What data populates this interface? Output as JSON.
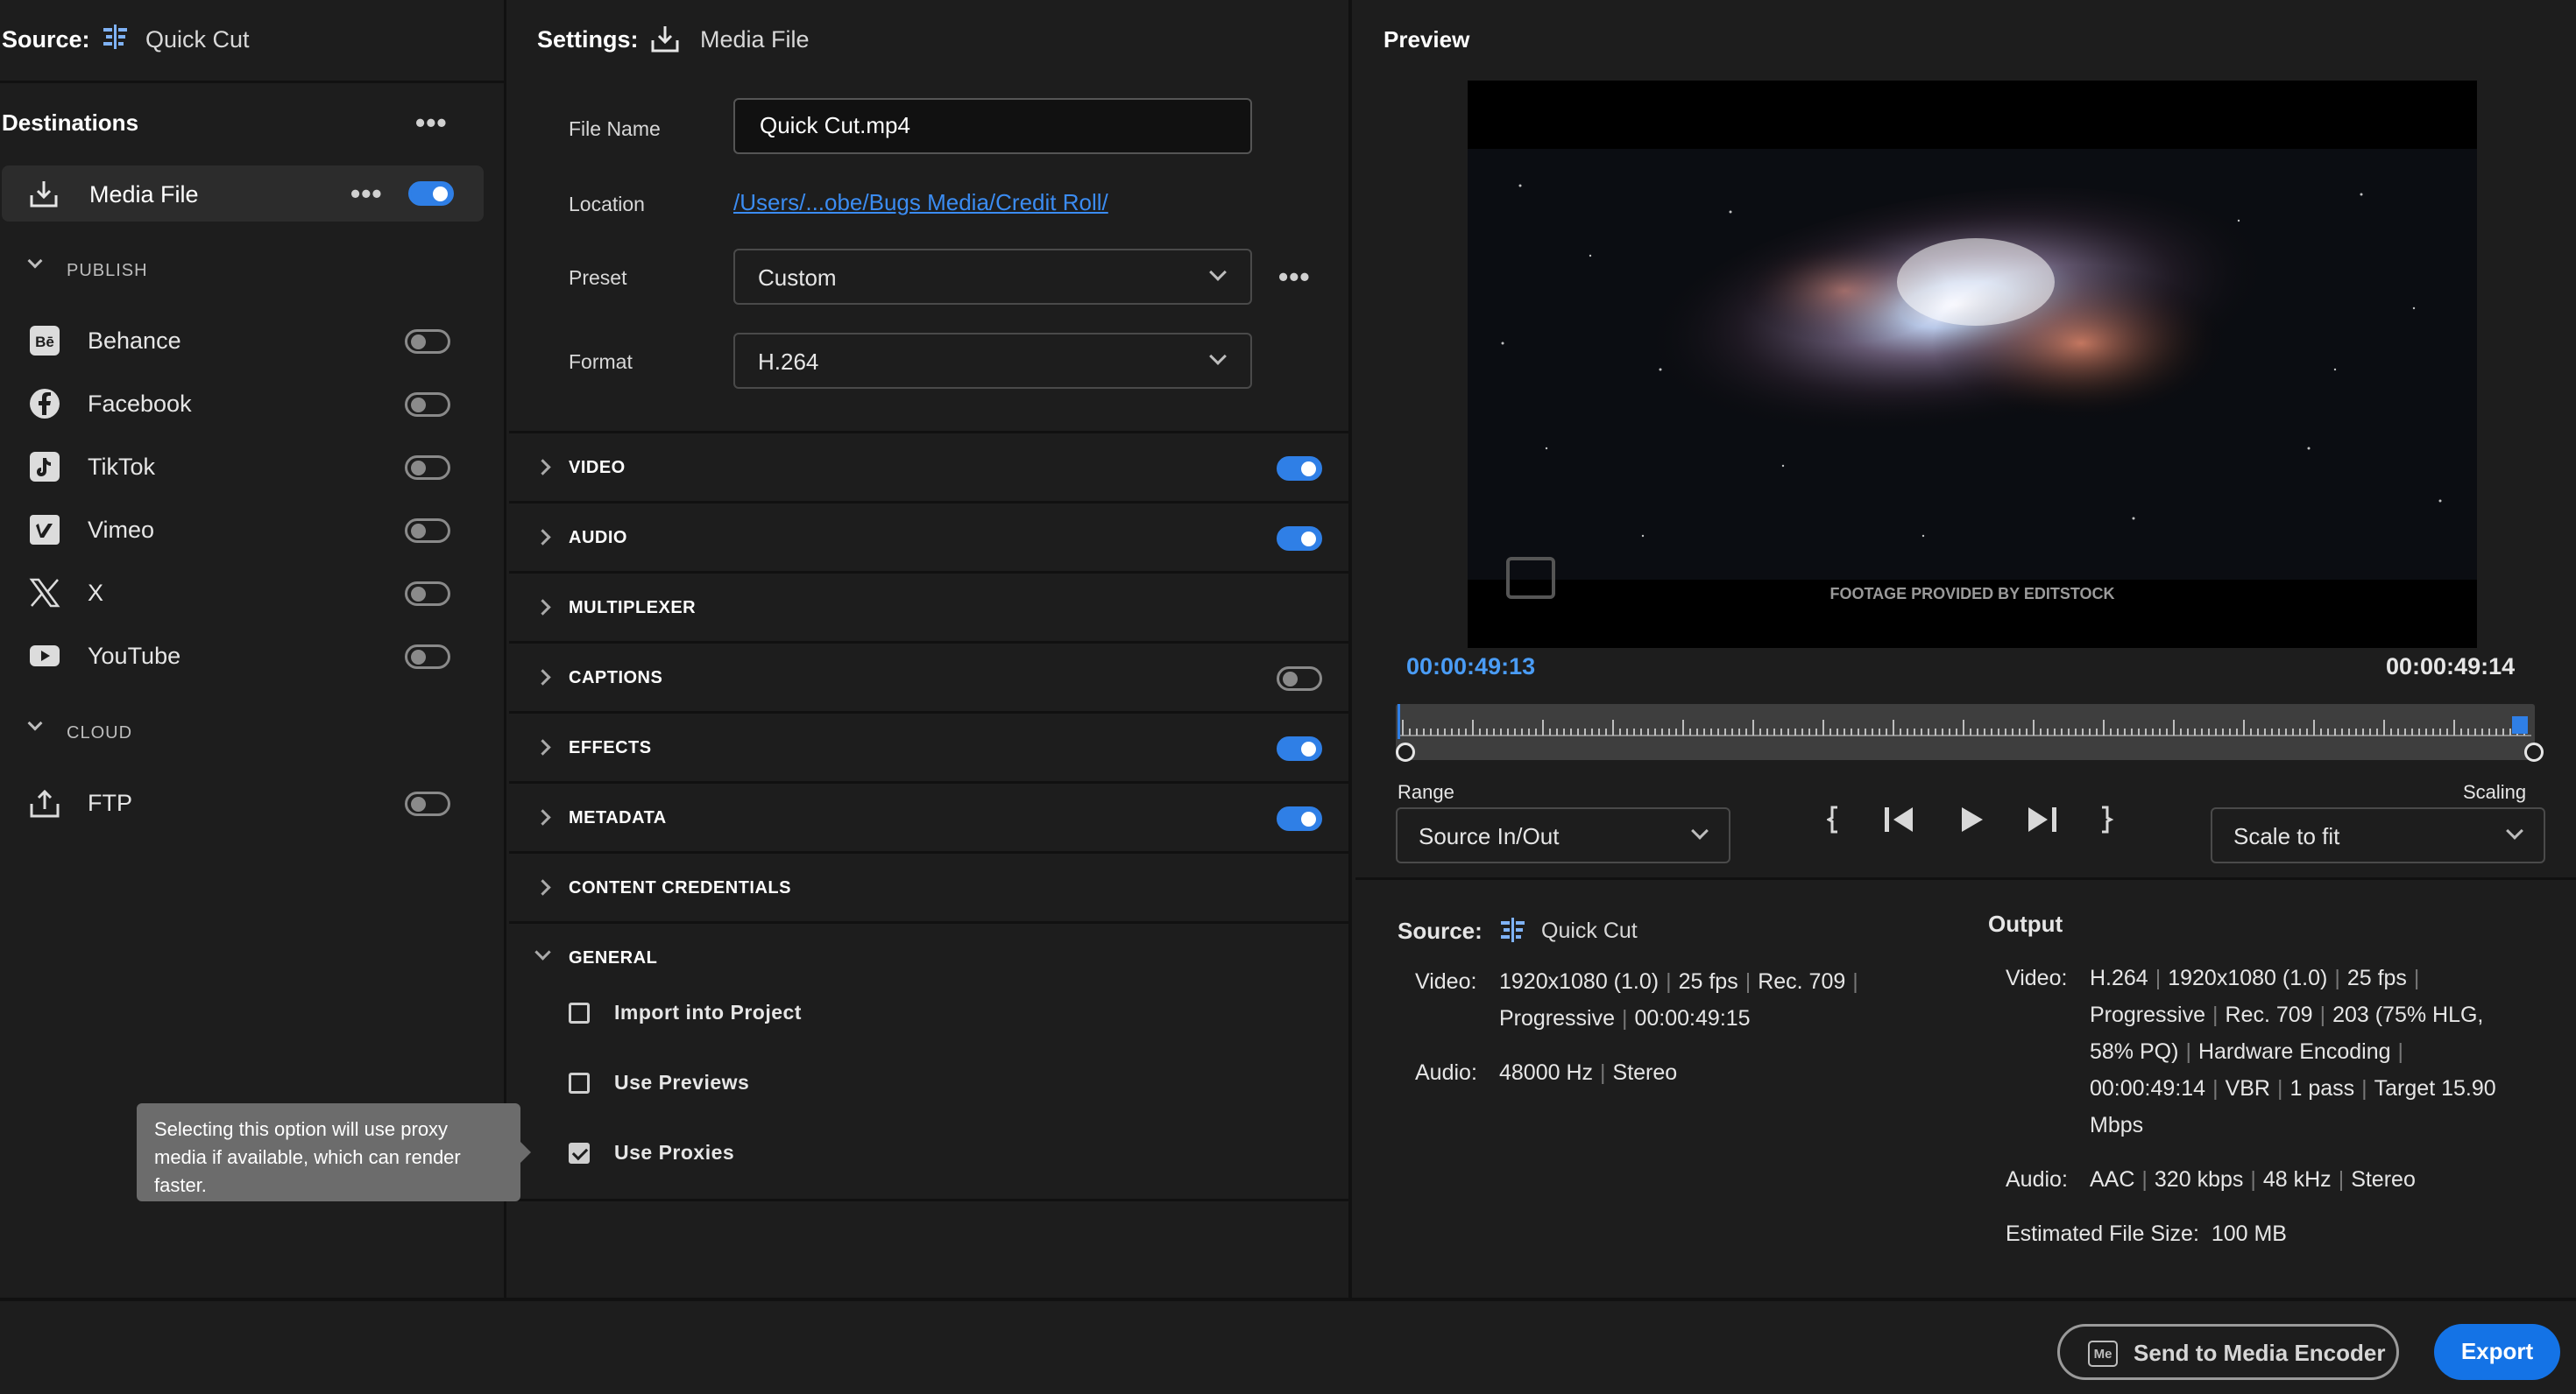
{
  "source": {
    "label": "Source:",
    "name": "Quick Cut"
  },
  "destinations": {
    "title": "Destinations",
    "media_file": {
      "label": "Media File",
      "enabled": true
    },
    "publish_header": "PUBLISH",
    "publish_items": [
      {
        "label": "Behance",
        "icon": "behance-icon",
        "enabled": false
      },
      {
        "label": "Facebook",
        "icon": "facebook-icon",
        "enabled": false
      },
      {
        "label": "TikTok",
        "icon": "tiktok-icon",
        "enabled": false
      },
      {
        "label": "Vimeo",
        "icon": "vimeo-icon",
        "enabled": false
      },
      {
        "label": "X",
        "icon": "x-icon",
        "enabled": false
      },
      {
        "label": "YouTube",
        "icon": "youtube-icon",
        "enabled": false
      }
    ],
    "cloud_header": "CLOUD",
    "cloud_items": [
      {
        "label": "FTP",
        "icon": "upload-icon",
        "enabled": false
      }
    ]
  },
  "tooltip": "Selecting this option will use proxy media if available, which can render faster.",
  "settings": {
    "label": "Settings:",
    "name": "Media File",
    "file_name_label": "File Name",
    "file_name_value": "Quick Cut.mp4",
    "location_label": "Location",
    "location_value": "/Users/...obe/Bugs Media/Credit Roll/",
    "preset_label": "Preset",
    "preset_value": "Custom",
    "format_label": "Format",
    "format_value": "H.264",
    "sections": [
      {
        "title": "VIDEO",
        "toggle": "on"
      },
      {
        "title": "AUDIO",
        "toggle": "on"
      },
      {
        "title": "MULTIPLEXER",
        "toggle": "none"
      },
      {
        "title": "CAPTIONS",
        "toggle": "off"
      },
      {
        "title": "EFFECTS",
        "toggle": "on"
      },
      {
        "title": "METADATA",
        "toggle": "on"
      },
      {
        "title": "CONTENT CREDENTIALS",
        "toggle": "none"
      }
    ],
    "general": {
      "title": "GENERAL",
      "options": [
        {
          "label": "Import into Project",
          "checked": false
        },
        {
          "label": "Use Previews",
          "checked": false
        },
        {
          "label": "Use Proxies",
          "checked": true
        }
      ]
    }
  },
  "preview": {
    "title": "Preview",
    "watermark": "FOOTAGE PROVIDED BY EDITSTOCK",
    "timecode_in": "00:00:49:13",
    "timecode_out": "00:00:49:14",
    "range_label": "Range",
    "range_value": "Source In/Out",
    "scaling_label": "Scaling",
    "scaling_value": "Scale to fit"
  },
  "source_info": {
    "label": "Source:",
    "name": "Quick Cut",
    "video_key": "Video:",
    "video_line1": [
      "1920x1080 (1.0)",
      "25 fps",
      "Rec. 709"
    ],
    "video_line2": [
      "Progressive",
      "00:00:49:15"
    ],
    "audio_key": "Audio:",
    "audio": [
      "48000 Hz",
      "Stereo"
    ]
  },
  "output_info": {
    "title": "Output",
    "video_key": "Video:",
    "video_lines": [
      [
        "H.264",
        "1920x1080 (1.0)",
        "25 fps"
      ],
      [
        "Progressive",
        "Rec. 709",
        "203 (75% HLG,"
      ],
      [
        "58% PQ)",
        "Hardware Encoding"
      ],
      [
        "00:00:49:14",
        "VBR",
        "1 pass",
        "Target 15.90"
      ],
      [
        "Mbps"
      ]
    ],
    "audio_key": "Audio:",
    "audio": [
      "AAC",
      "320 kbps",
      "48 kHz",
      "Stereo"
    ],
    "size_key": "Estimated File Size:",
    "size_value": "100 MB"
  },
  "footer": {
    "encoder_label": "Send to Media Encoder",
    "encoder_icon_text": "Me",
    "export_label": "Export"
  },
  "colors": {
    "accent": "#1473e6",
    "link": "#3b8cf2",
    "timecode": "#4a9cf5"
  }
}
